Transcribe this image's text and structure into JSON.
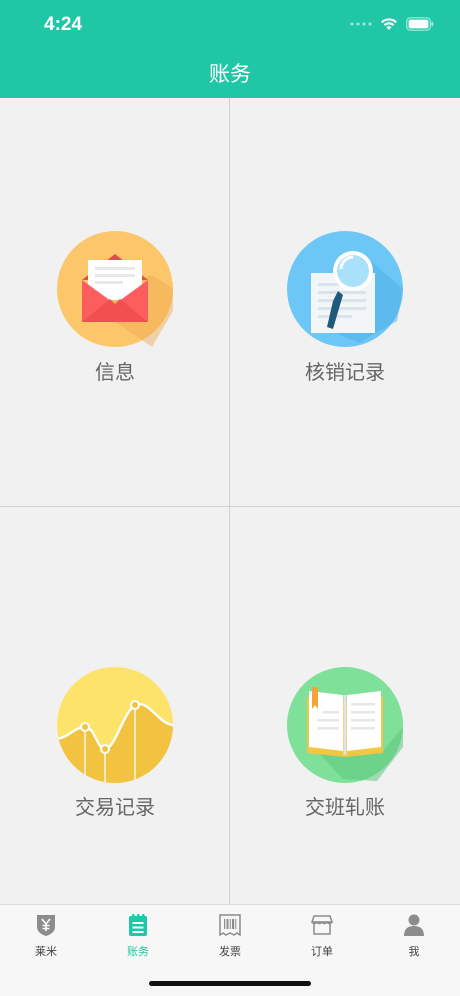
{
  "status_bar": {
    "time": "4:24"
  },
  "header": {
    "title": "账务"
  },
  "grid": {
    "items": [
      {
        "label": "信息",
        "icon": "mail-envelope-icon"
      },
      {
        "label": "核销记录",
        "icon": "magnifier-document-icon"
      },
      {
        "label": "交易记录",
        "icon": "line-chart-icon"
      },
      {
        "label": "交班轧账",
        "icon": "open-book-icon"
      }
    ]
  },
  "tabbar": {
    "items": [
      {
        "label": "莱米",
        "icon": "yen-shield-icon",
        "active": false
      },
      {
        "label": "账务",
        "icon": "notepad-icon",
        "active": true
      },
      {
        "label": "发票",
        "icon": "barcode-invoice-icon",
        "active": false
      },
      {
        "label": "订单",
        "icon": "storefront-icon",
        "active": false
      },
      {
        "label": "我",
        "icon": "person-icon",
        "active": false
      }
    ]
  },
  "colors": {
    "brand": "#1fc7a6",
    "background": "#f1f1f1",
    "label": "#666666"
  }
}
